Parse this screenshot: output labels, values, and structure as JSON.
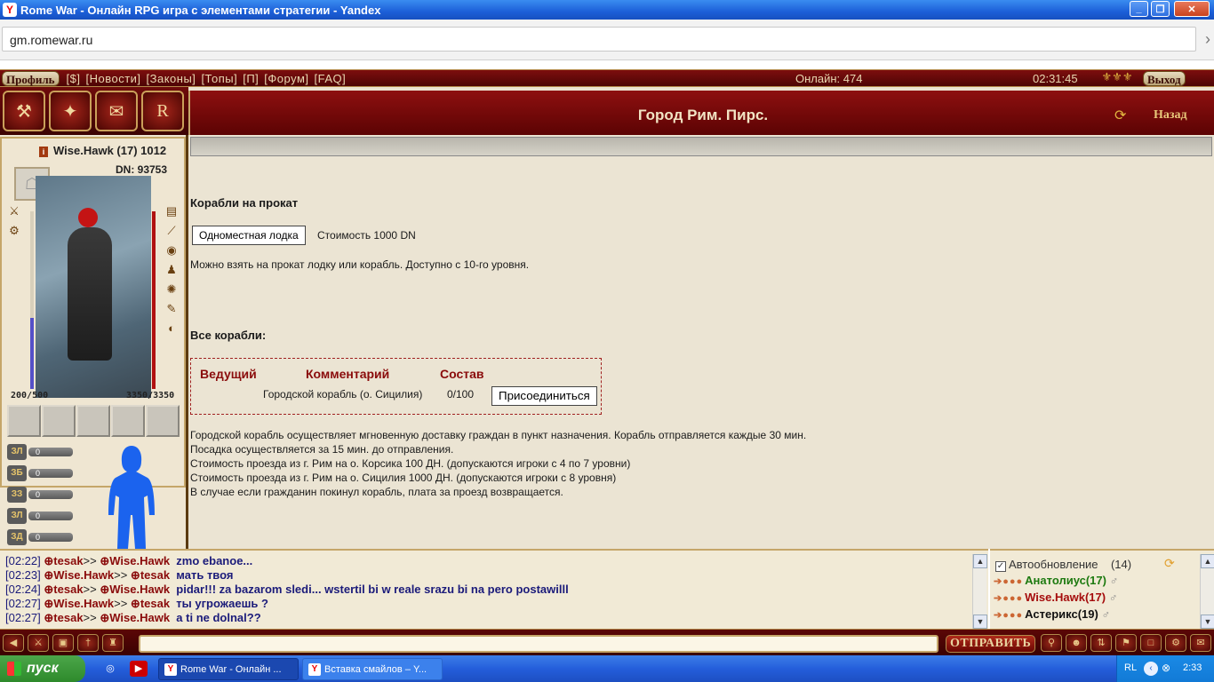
{
  "window": {
    "title": "Rome War - Онлайн RPG игра с элементами стратегии - Yandex",
    "icon": "yandex-icon",
    "minimize": "_",
    "maximize": "❐",
    "close": "✕"
  },
  "address": {
    "url": "gm.romewar.ru"
  },
  "gamenav": {
    "profile": "Профиль",
    "links": [
      "[$]",
      "[Новости]",
      "[Законы]",
      "[Топы]",
      "[П]",
      "[Форум]",
      "[FAQ]"
    ],
    "online": "Онлайн: 474",
    "clock": "02:31:45",
    "exit": "Выход"
  },
  "character": {
    "name": "Wise.Hawk (17) 1012",
    "dn": "DN: 93753",
    "hp": "200/500",
    "mp": "3350/3350",
    "hp_fraction": 0.4,
    "stats": [
      {
        "label": "ЗЛ",
        "value": "0"
      },
      {
        "label": "ЗБ",
        "value": "0"
      },
      {
        "label": "ЗЗ",
        "value": "0"
      },
      {
        "label": "ЗЛ",
        "value": "0"
      },
      {
        "label": "ЗД",
        "value": "0"
      }
    ]
  },
  "header": {
    "city": "Город Рим. Пирс.",
    "back": "Назад"
  },
  "rent": {
    "title": "Корабли на прокат",
    "boat_button": "Одноместная лодка",
    "boat_cost": "Стоимость 1000 DN",
    "desc": "Можно взять на прокат лодку или корабль. Доступно с 10-го уровня."
  },
  "ships": {
    "title": "Все корабли:",
    "headers": [
      "Ведущий",
      "Комментарий",
      "Состав"
    ],
    "row": {
      "comment": "Городской корабль (о. Сицилия)",
      "count": "0/100",
      "join": "Присоединиться"
    }
  },
  "info": [
    "Городской корабль осуществляет мгновенную доставку граждан в пункт назначения. Корабль отправляется каждые 30 мин.",
    "Посадка осуществляется за 15 мин. до отправления.",
    "Стоимость проезда из г. Рим на о. Корсика 100 ДН. (допускаются игроки с 4 по 7 уровни)",
    "Стоимость проезда из г. Рим на о. Сицилия 1000 ДН. (допускаются игроки с 8 уровня)",
    "В случае если гражданин покинул корабль, плата за проезд возвращается."
  ],
  "chat": [
    {
      "time": "[02:22]",
      "from": "tesak",
      "to": "Wise.Hawk",
      "msg": "zmo ebanoe..."
    },
    {
      "time": "[02:23]",
      "from": "Wise.Hawk",
      "to": "tesak",
      "msg": "мать твоя"
    },
    {
      "time": "[02:24]",
      "from": "tesak",
      "to": "Wise.Hawk",
      "msg": "pidar!!! za bazarom sledi... wstertil bi w reale srazu bi na pero postawilll"
    },
    {
      "time": "[02:27]",
      "from": "Wise.Hawk",
      "to": "tesak",
      "msg": "ты угрожаешь ?"
    },
    {
      "time": "[02:27]",
      "from": "tesak",
      "to": "Wise.Hawk",
      "msg": "a ti ne dolnal??"
    }
  ],
  "users": {
    "autoupdate": "Автообновление",
    "count": "(14)",
    "list": [
      {
        "name": "Анатолиус",
        "level": "(17)",
        "color": "#1d7a10"
      },
      {
        "name": "Wise.Hawk",
        "level": "(17)",
        "color": "#a50c0c"
      },
      {
        "name": "Астерикс",
        "level": "(19)",
        "color": "#111111"
      }
    ]
  },
  "input": {
    "send": "ОТПРАВИТЬ"
  },
  "taskbar": {
    "start": "пуск",
    "tasks": [
      "Rome War - Онлайн ...",
      "Вставка смайлов – Y..."
    ],
    "lang": "RL",
    "time": "2:33"
  }
}
